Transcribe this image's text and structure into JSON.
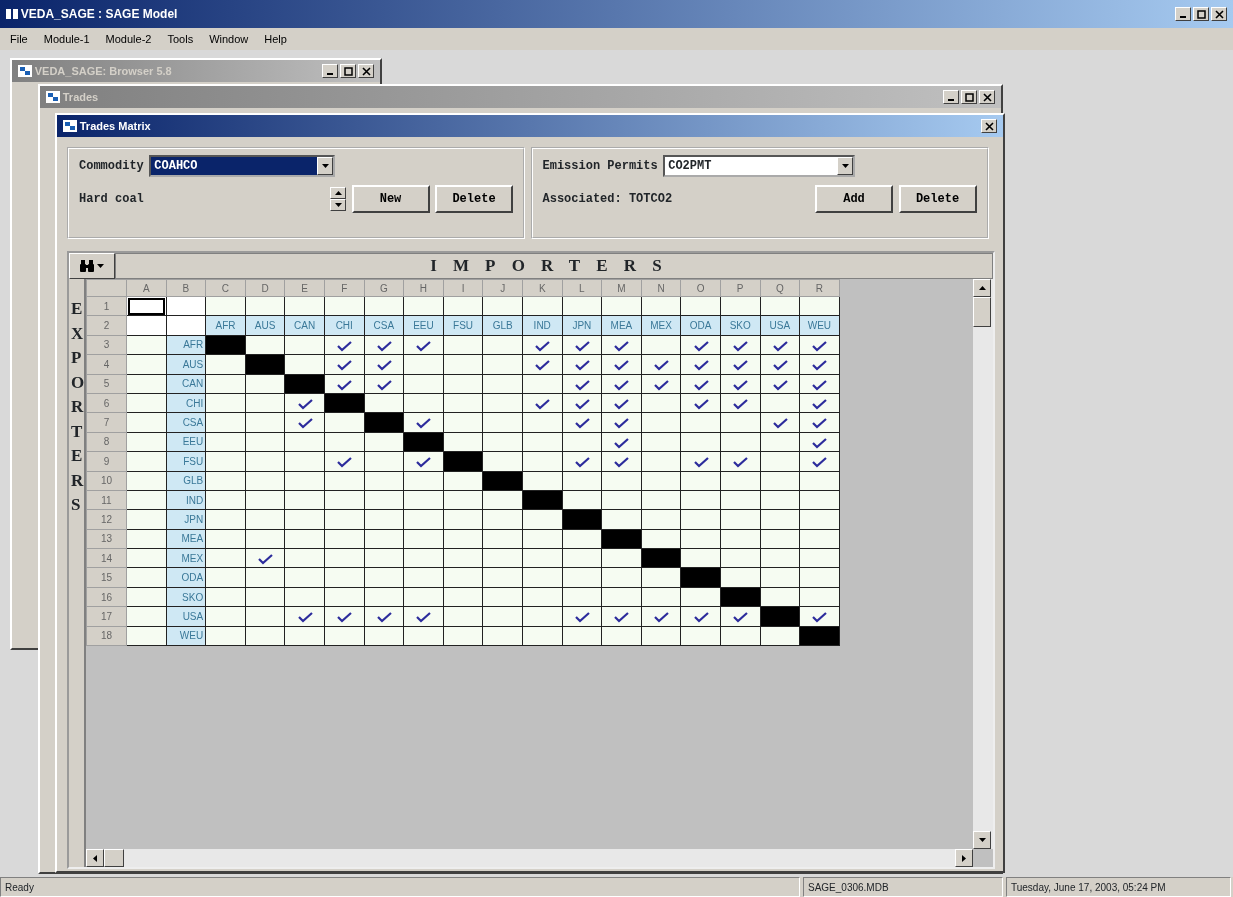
{
  "app": {
    "title": "VEDA_SAGE : SAGE Model",
    "menu": [
      "File",
      "Module-1",
      "Module-2",
      "Tools",
      "Window",
      "Help"
    ]
  },
  "browser_window": {
    "title": "VEDA_SAGE: Browser 5.8"
  },
  "trades_window": {
    "title": "Trades"
  },
  "matrix_window": {
    "title": "Trades Matrix",
    "commodity": {
      "label": "Commodity",
      "value": "COAHCO",
      "selected": true,
      "description": "Hard coal",
      "buttons": [
        "New",
        "Delete"
      ]
    },
    "emission": {
      "label": "Emission Permits",
      "value": "CO2PMT",
      "selected": false,
      "associated": "Associated: TOTCO2",
      "buttons": [
        "Add",
        "Delete"
      ]
    },
    "importers_label": "IMPORTERS",
    "exporters_label": "EXPORTERS",
    "grid": {
      "column_letters": [
        "A",
        "B",
        "C",
        "D",
        "E",
        "F",
        "G",
        "H",
        "I",
        "J",
        "K",
        "L",
        "M",
        "N",
        "O",
        "P",
        "Q",
        "R"
      ],
      "header_row_numbers": [
        "1",
        "2"
      ],
      "importers": [
        "AFR",
        "AUS",
        "CAN",
        "CHI",
        "CSA",
        "EEU",
        "FSU",
        "GLB",
        "IND",
        "JPN",
        "MEA",
        "MEX",
        "ODA",
        "SKO",
        "USA",
        "WEU"
      ],
      "rows": [
        {
          "number": "3",
          "exporter": "AFR",
          "checked": [
            false,
            false,
            false,
            true,
            true,
            true,
            false,
            false,
            true,
            true,
            true,
            false,
            true,
            true,
            true,
            true
          ],
          "blocked": [
            true,
            false,
            false,
            false,
            false,
            false,
            false,
            false,
            false,
            false,
            false,
            false,
            false,
            false,
            false,
            false
          ]
        },
        {
          "number": "4",
          "exporter": "AUS",
          "checked": [
            false,
            false,
            false,
            true,
            true,
            false,
            false,
            false,
            true,
            true,
            true,
            true,
            true,
            true,
            true,
            true
          ],
          "blocked": [
            false,
            true,
            false,
            false,
            false,
            false,
            false,
            false,
            false,
            false,
            false,
            false,
            false,
            false,
            false,
            false
          ]
        },
        {
          "number": "5",
          "exporter": "CAN",
          "checked": [
            false,
            false,
            false,
            true,
            true,
            false,
            false,
            false,
            false,
            true,
            true,
            true,
            true,
            true,
            true,
            true
          ],
          "blocked": [
            false,
            false,
            true,
            false,
            false,
            false,
            false,
            false,
            false,
            false,
            false,
            false,
            false,
            false,
            false,
            false
          ]
        },
        {
          "number": "6",
          "exporter": "CHI",
          "checked": [
            false,
            false,
            true,
            false,
            false,
            false,
            false,
            false,
            true,
            true,
            true,
            false,
            true,
            true,
            false,
            true
          ],
          "blocked": [
            false,
            false,
            false,
            true,
            false,
            false,
            false,
            false,
            false,
            false,
            false,
            false,
            false,
            false,
            false,
            false
          ]
        },
        {
          "number": "7",
          "exporter": "CSA",
          "checked": [
            false,
            false,
            true,
            false,
            false,
            true,
            false,
            false,
            false,
            true,
            true,
            false,
            false,
            false,
            true,
            true
          ],
          "blocked": [
            false,
            false,
            false,
            false,
            true,
            false,
            false,
            false,
            false,
            false,
            false,
            false,
            false,
            false,
            false,
            false
          ]
        },
        {
          "number": "8",
          "exporter": "EEU",
          "checked": [
            false,
            false,
            false,
            false,
            false,
            false,
            false,
            false,
            false,
            false,
            true,
            false,
            false,
            false,
            false,
            true
          ],
          "blocked": [
            false,
            false,
            false,
            false,
            false,
            true,
            false,
            false,
            false,
            false,
            false,
            false,
            false,
            false,
            false,
            false
          ]
        },
        {
          "number": "9",
          "exporter": "FSU",
          "checked": [
            false,
            false,
            false,
            true,
            false,
            true,
            false,
            false,
            false,
            true,
            true,
            false,
            true,
            true,
            false,
            true
          ],
          "blocked": [
            false,
            false,
            false,
            false,
            false,
            false,
            true,
            false,
            false,
            false,
            false,
            false,
            false,
            false,
            false,
            false
          ]
        },
        {
          "number": "10",
          "exporter": "GLB",
          "checked": [
            false,
            false,
            false,
            false,
            false,
            false,
            false,
            false,
            false,
            false,
            false,
            false,
            false,
            false,
            false,
            false
          ],
          "blocked": [
            false,
            false,
            false,
            false,
            false,
            false,
            false,
            true,
            false,
            false,
            false,
            false,
            false,
            false,
            false,
            false
          ]
        },
        {
          "number": "11",
          "exporter": "IND",
          "checked": [
            false,
            false,
            false,
            false,
            false,
            false,
            false,
            false,
            false,
            false,
            false,
            false,
            false,
            false,
            false,
            false
          ],
          "blocked": [
            false,
            false,
            false,
            false,
            false,
            false,
            false,
            false,
            true,
            false,
            false,
            false,
            false,
            false,
            false,
            false
          ]
        },
        {
          "number": "12",
          "exporter": "JPN",
          "checked": [
            false,
            false,
            false,
            false,
            false,
            false,
            false,
            false,
            false,
            false,
            false,
            false,
            false,
            false,
            false,
            false
          ],
          "blocked": [
            false,
            false,
            false,
            false,
            false,
            false,
            false,
            false,
            false,
            true,
            false,
            false,
            false,
            false,
            false,
            false
          ]
        },
        {
          "number": "13",
          "exporter": "MEA",
          "checked": [
            false,
            false,
            false,
            false,
            false,
            false,
            false,
            false,
            false,
            false,
            false,
            false,
            false,
            false,
            false,
            false
          ],
          "blocked": [
            false,
            false,
            false,
            false,
            false,
            false,
            false,
            false,
            false,
            false,
            true,
            false,
            false,
            false,
            false,
            false
          ]
        },
        {
          "number": "14",
          "exporter": "MEX",
          "checked": [
            false,
            true,
            false,
            false,
            false,
            false,
            false,
            false,
            false,
            false,
            false,
            false,
            false,
            false,
            false,
            false
          ],
          "blocked": [
            false,
            false,
            false,
            false,
            false,
            false,
            false,
            false,
            false,
            false,
            false,
            true,
            false,
            false,
            false,
            false
          ]
        },
        {
          "number": "15",
          "exporter": "ODA",
          "checked": [
            false,
            false,
            false,
            false,
            false,
            false,
            false,
            false,
            false,
            false,
            false,
            false,
            false,
            false,
            false,
            false
          ],
          "blocked": [
            false,
            false,
            false,
            false,
            false,
            false,
            false,
            false,
            false,
            false,
            false,
            false,
            true,
            false,
            false,
            false
          ]
        },
        {
          "number": "16",
          "exporter": "SKO",
          "checked": [
            false,
            false,
            false,
            false,
            false,
            false,
            false,
            false,
            false,
            false,
            false,
            false,
            false,
            false,
            false,
            false
          ],
          "blocked": [
            false,
            false,
            false,
            false,
            false,
            false,
            false,
            false,
            false,
            false,
            false,
            false,
            false,
            true,
            false,
            false
          ]
        },
        {
          "number": "17",
          "exporter": "USA",
          "checked": [
            false,
            false,
            true,
            true,
            true,
            true,
            false,
            false,
            false,
            true,
            true,
            true,
            true,
            true,
            false,
            true
          ],
          "blocked": [
            false,
            false,
            false,
            false,
            false,
            false,
            false,
            false,
            false,
            false,
            false,
            false,
            false,
            false,
            true,
            false
          ]
        },
        {
          "number": "18",
          "exporter": "WEU",
          "checked": [
            false,
            false,
            false,
            false,
            false,
            false,
            false,
            false,
            false,
            false,
            false,
            false,
            false,
            false,
            false,
            false
          ],
          "blocked": [
            false,
            false,
            false,
            false,
            false,
            false,
            false,
            false,
            false,
            false,
            false,
            false,
            false,
            false,
            false,
            true
          ]
        }
      ]
    }
  },
  "status_bar": [
    "Ready",
    "SAGE_0306.MDB",
    "Tuesday, June 17, 2003, 05:24 PM"
  ]
}
